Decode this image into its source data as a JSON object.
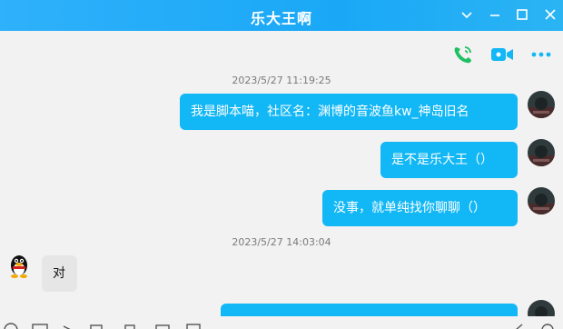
{
  "window": {
    "title": "乐大王啊",
    "accent": "#12b7f5"
  },
  "toolbar": {
    "icons": [
      "phone-call-icon",
      "video-call-icon",
      "more-icon"
    ]
  },
  "messages": [
    {
      "type": "timestamp",
      "text": "2023/5/27 11:19:25"
    },
    {
      "type": "outgoing",
      "text": "我是脚本喵，社区名：渊博的音波鱼kw_神岛旧名"
    },
    {
      "type": "outgoing",
      "text": "是不是乐大王（）"
    },
    {
      "type": "outgoing",
      "text": "没事，就单纯找你聊聊（）"
    },
    {
      "type": "timestamp",
      "text": "2023/5/27 14:03:04"
    },
    {
      "type": "incoming",
      "text": "对"
    },
    {
      "type": "outgoing",
      "text": ""
    }
  ]
}
